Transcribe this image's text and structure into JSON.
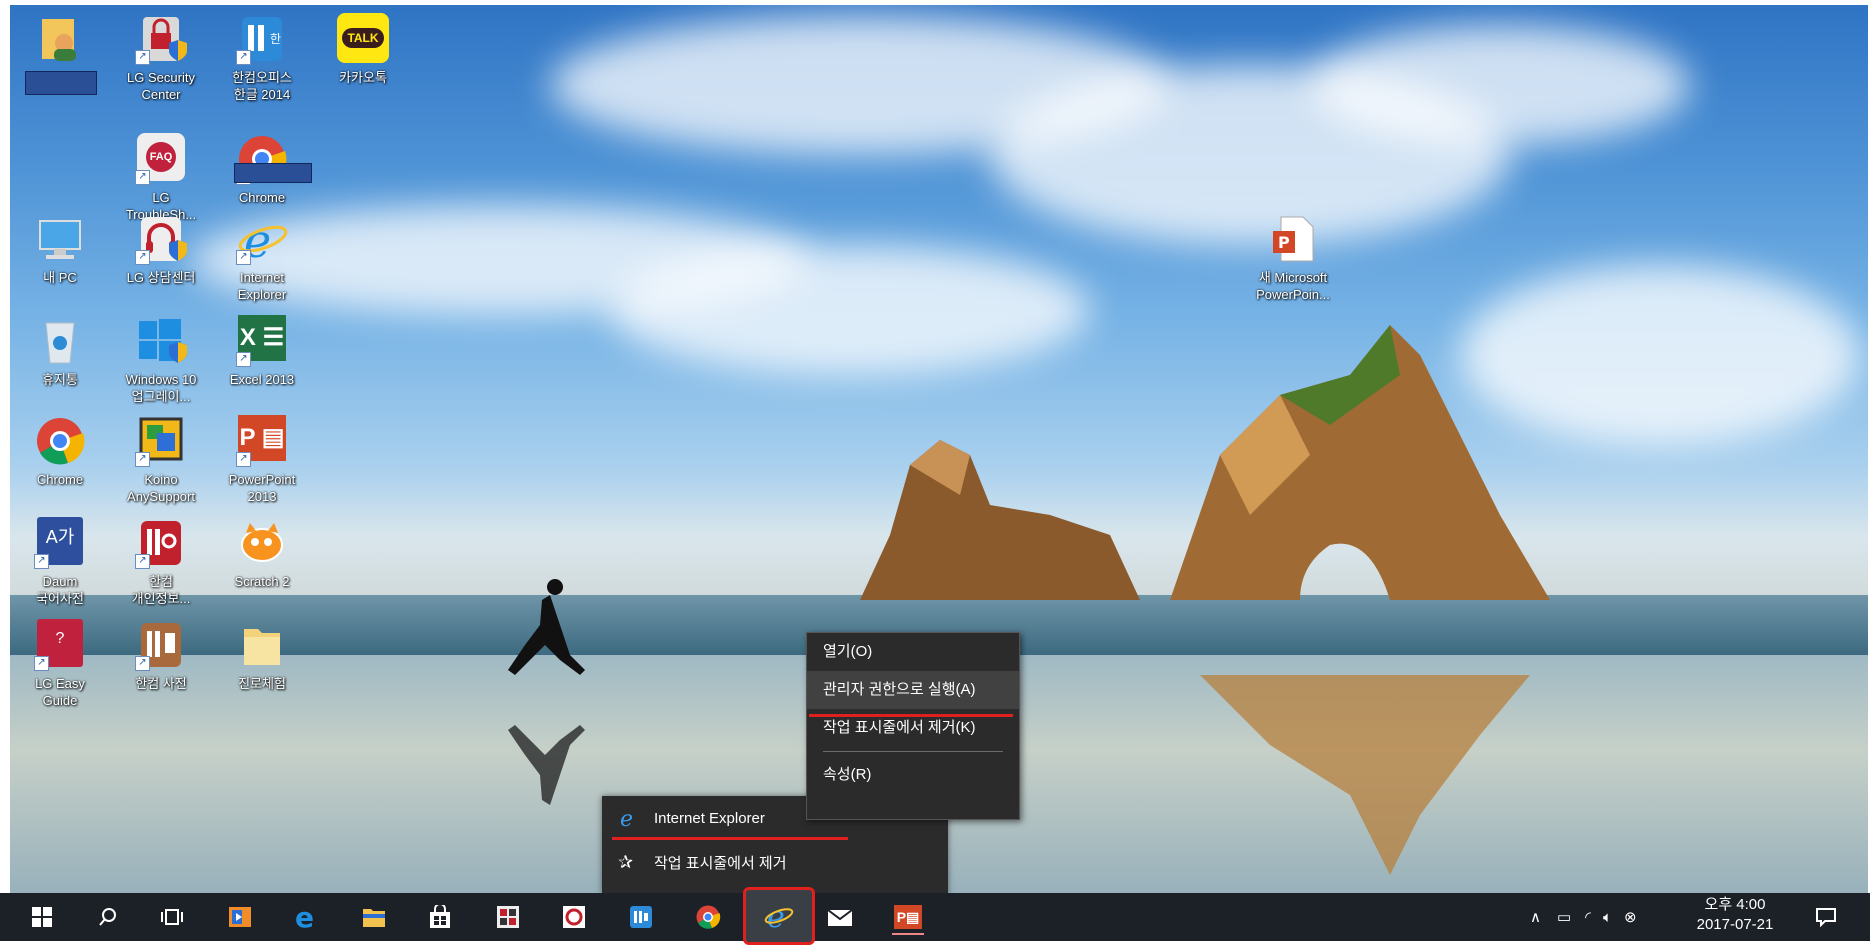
{
  "desktop": {
    "icons": [
      {
        "id": "user-folder",
        "label": ""
      },
      {
        "id": "lg-security",
        "label": "LG Security\nCenter"
      },
      {
        "id": "hancom-office",
        "label": "한컴오피스\n한글 2014"
      },
      {
        "id": "kakaotalk",
        "label": "카카오톡",
        "badge": "TALK"
      },
      {
        "id": "lg-troubleshoot",
        "label": "LG\nTroubleSh...",
        "badge": "FAQ"
      },
      {
        "id": "chrome-1",
        "label": "Chrome"
      },
      {
        "id": "my-pc",
        "label": "내 PC"
      },
      {
        "id": "lg-center",
        "label": "LG 상담센터"
      },
      {
        "id": "internet-explorer",
        "label": "Internet\nExplorer"
      },
      {
        "id": "recycle-bin",
        "label": "휴지통"
      },
      {
        "id": "windows10-upgrade",
        "label": "Windows 10\n업그레이..."
      },
      {
        "id": "excel",
        "label": "Excel 2013",
        "badge": "X"
      },
      {
        "id": "chrome-2",
        "label": "Chrome"
      },
      {
        "id": "koino",
        "label": "Koino\nAnySupport"
      },
      {
        "id": "powerpoint",
        "label": "PowerPoint\n2013",
        "badge": "P"
      },
      {
        "id": "daum-dict",
        "label": "Daum\n국어사전",
        "badge": "A가"
      },
      {
        "id": "hancom-privacy",
        "label": "한컴\n개인정보..."
      },
      {
        "id": "scratch",
        "label": "Scratch 2"
      },
      {
        "id": "lg-easy-guide",
        "label": "LG Easy\nGuide",
        "badge": "?"
      },
      {
        "id": "hancom-dict",
        "label": "한컴 사전"
      },
      {
        "id": "career-folder",
        "label": "진로체험"
      },
      {
        "id": "new-ppt",
        "label": "새 Microsoft\nPowerPoin...",
        "badge": "P"
      }
    ]
  },
  "context_menu": {
    "items": [
      "열기(O)",
      "관리자 권한으로 실행(A)",
      "작업 표시줄에서 제거(K)",
      "속성(R)"
    ]
  },
  "jump_list": {
    "app_name": "Internet Explorer",
    "unpin": "작업 표시줄에서 제거"
  },
  "taskbar": {
    "clock_time": "오후 4:00",
    "clock_date": "2017-07-21",
    "ppt_badge": "P"
  },
  "colors": {
    "highlight_red": "#e01f1f",
    "taskbar": "#1c2127",
    "menu_bg": "#2b2b2b"
  }
}
